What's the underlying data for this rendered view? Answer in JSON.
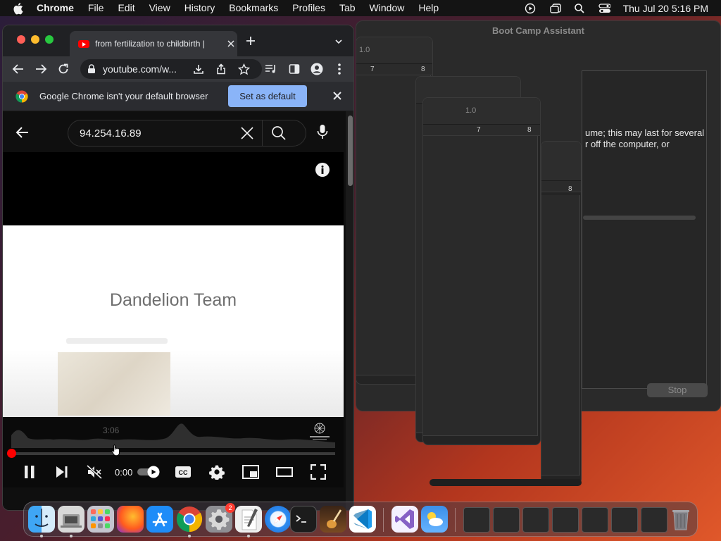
{
  "menubar": {
    "app_name": "Chrome",
    "menus": [
      "File",
      "Edit",
      "View",
      "History",
      "Bookmarks",
      "Profiles",
      "Tab",
      "Window",
      "Help"
    ],
    "clock": "Thu Jul 20  5:16 PM"
  },
  "bootcamp": {
    "title": "Boot Camp Assistant",
    "message_line1": "ume; this may last for several",
    "message_line2": "r off the computer, or",
    "stop_label": "Stop"
  },
  "docwins": {
    "spacing_label": "1.0",
    "ruler_7": "7",
    "ruler_8": "8"
  },
  "chrome": {
    "tab_title": "from fertilization to childbirth |",
    "url": "youtube.com/w...",
    "infobar_message": "Google Chrome isn't your default browser",
    "set_default_label": "Set as default"
  },
  "youtube": {
    "search_query": "94.254.16.89",
    "slide_title": "Dandelion Team",
    "hover_time": "3:06",
    "current_time": "0:00",
    "progress_fraction": 0.0
  },
  "dock": {
    "settings_badge": "2"
  },
  "colors": {
    "accent_blue": "#8ab4f8",
    "youtube_red": "#ff0000",
    "menubar_bg": "#141414"
  }
}
